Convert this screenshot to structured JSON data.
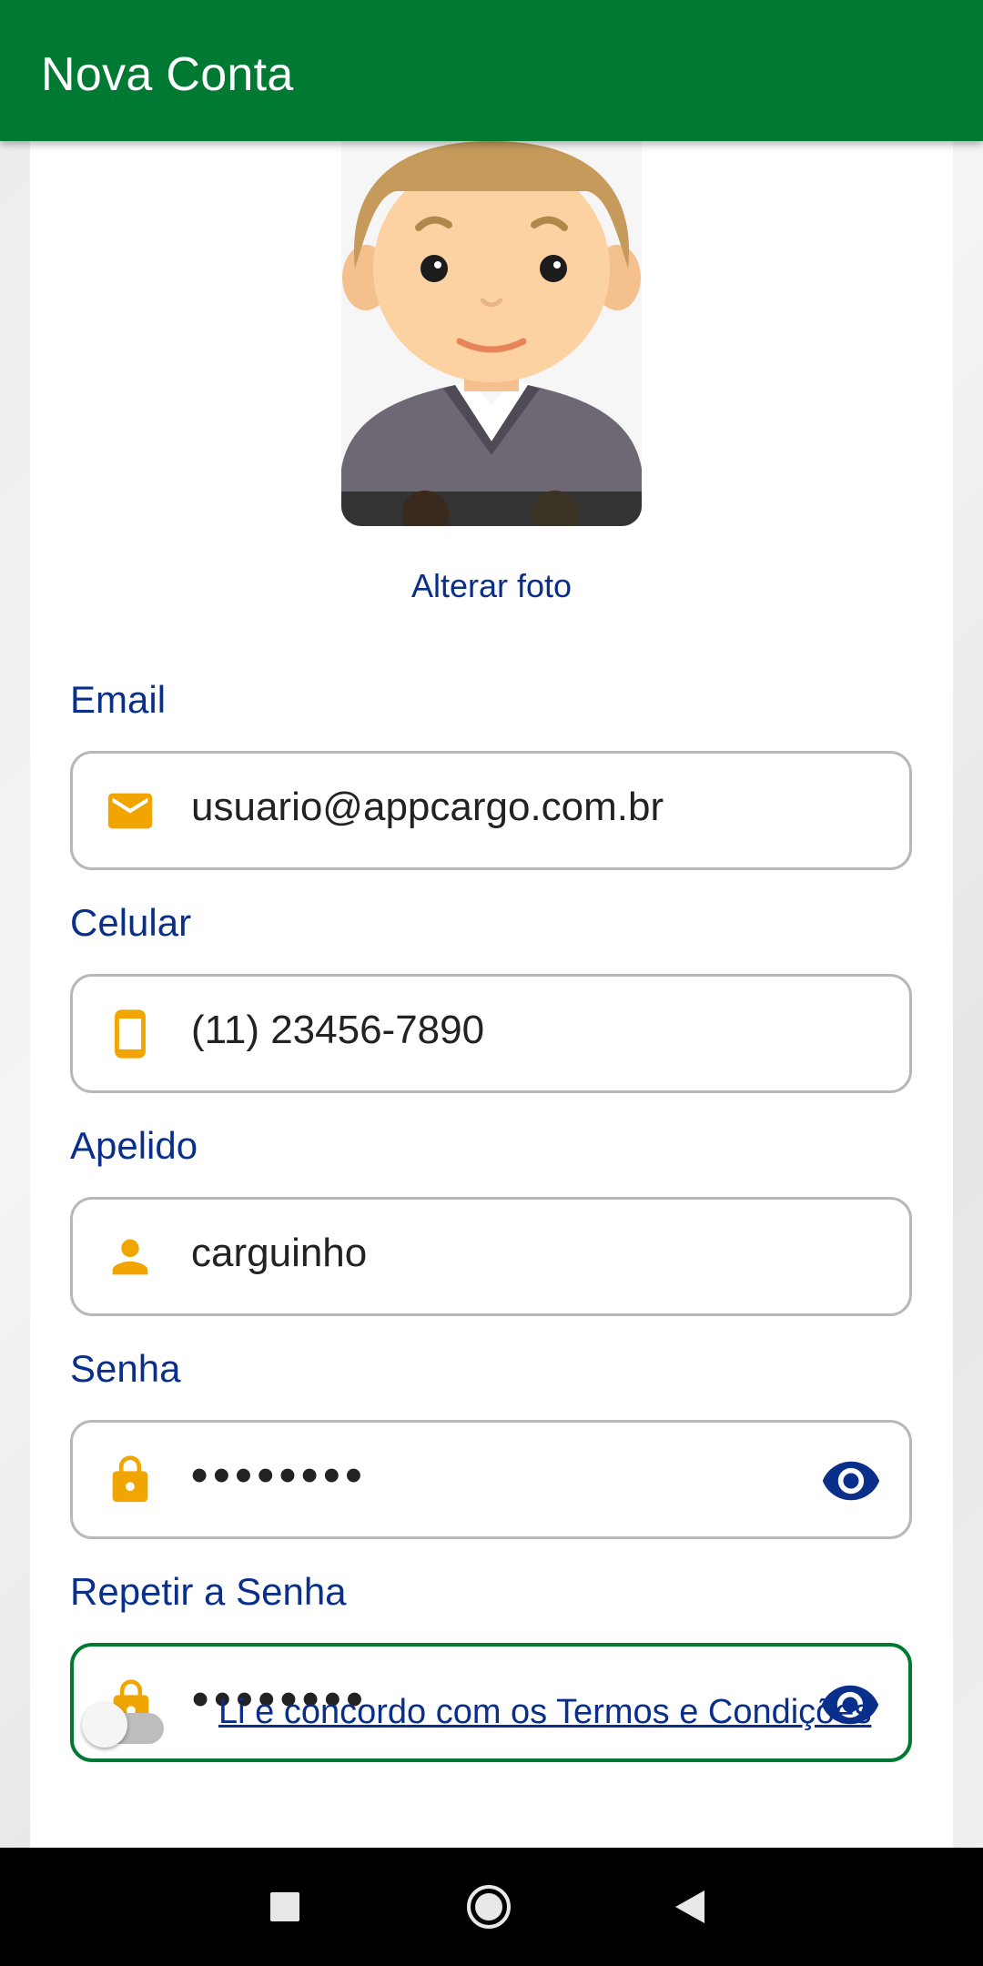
{
  "appbar": {
    "title": "Nova Conta"
  },
  "profile": {
    "change_photo_label": "Alterar foto"
  },
  "fields": {
    "email": {
      "label": "Email",
      "value": "usuario@appcargo.com.br",
      "icon": "email-icon"
    },
    "phone": {
      "label": "Celular",
      "value": "(11) 23456-7890",
      "icon": "phone-icon"
    },
    "nickname": {
      "label": "Apelido",
      "value": "carguinho",
      "icon": "person-icon"
    },
    "password": {
      "label": "Senha",
      "value": "••••••••",
      "icon": "lock-icon"
    },
    "password_repeat": {
      "label": "Repetir a Senha",
      "value": "••••••••",
      "icon": "lock-icon"
    }
  },
  "terms": {
    "label": "Li e concordo com os Termos e Condições",
    "accepted": false
  },
  "colors": {
    "primary": "#007a33",
    "label": "#0a2f8a",
    "icon": "#f0a500",
    "border": "#b8b8b8"
  },
  "navbar": {
    "buttons": [
      "recents-icon",
      "home-icon",
      "back-icon"
    ]
  }
}
